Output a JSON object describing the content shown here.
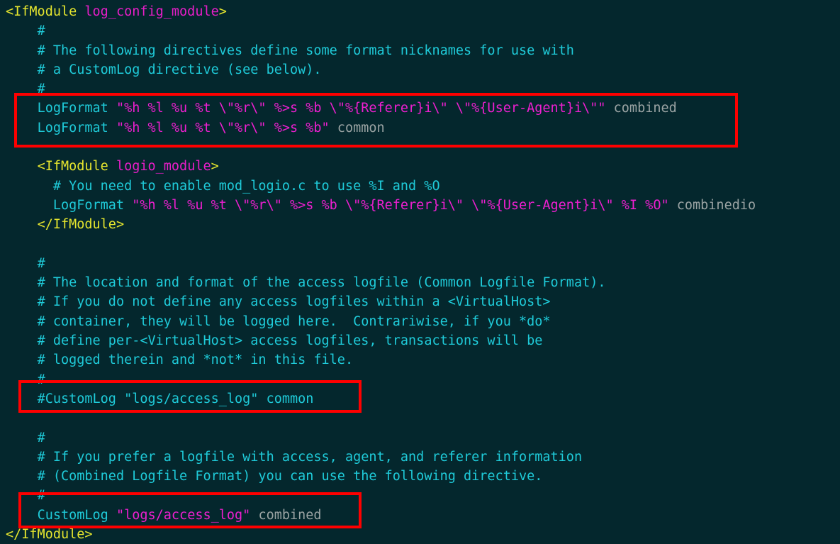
{
  "window": {
    "background_color": "#04272d",
    "content_type": "apache-httpd-config",
    "highlight_color": "#ff0000"
  },
  "colors": {
    "tag": "#e5e52e",
    "module_name": "#e81ec8",
    "comment": "#1fcbd9",
    "directive": "#1fcbd9",
    "string": "#ee1fd0",
    "argument": "#9aa3a3"
  },
  "code_lines": [
    {
      "indent": 0,
      "tokens": [
        {
          "text": "<IfModule ",
          "type": "tag"
        },
        {
          "text": "log_config_module",
          "type": "module"
        },
        {
          "text": ">",
          "type": "tag"
        }
      ]
    },
    {
      "indent": 4,
      "tokens": [
        {
          "text": "#",
          "type": "comment"
        }
      ]
    },
    {
      "indent": 4,
      "tokens": [
        {
          "text": "# The following directives define some format nicknames for use with",
          "type": "comment"
        }
      ]
    },
    {
      "indent": 4,
      "tokens": [
        {
          "text": "# a CustomLog directive (see below).",
          "type": "comment"
        }
      ]
    },
    {
      "indent": 4,
      "tokens": [
        {
          "text": "#",
          "type": "comment"
        }
      ]
    },
    {
      "indent": 4,
      "tokens": [
        {
          "text": "LogFormat ",
          "type": "directive"
        },
        {
          "text": "\"%h %l %u %t \\\"%r\\\" %>s %b \\\"%{Referer}i\\\" \\\"%{User-Agent}i\\\"\"",
          "type": "string"
        },
        {
          "text": " combined",
          "type": "argument"
        }
      ]
    },
    {
      "indent": 4,
      "tokens": [
        {
          "text": "LogFormat ",
          "type": "directive"
        },
        {
          "text": "\"%h %l %u %t \\\"%r\\\" %>s %b\"",
          "type": "string"
        },
        {
          "text": " common",
          "type": "argument"
        }
      ]
    },
    {
      "indent": 0,
      "tokens": []
    },
    {
      "indent": 4,
      "tokens": [
        {
          "text": "<IfModule ",
          "type": "tag"
        },
        {
          "text": "logio_module",
          "type": "module"
        },
        {
          "text": ">",
          "type": "tag"
        }
      ]
    },
    {
      "indent": 6,
      "tokens": [
        {
          "text": "# You need to enable mod_logio.c to use %I and %O",
          "type": "comment"
        }
      ]
    },
    {
      "indent": 6,
      "tokens": [
        {
          "text": "LogFormat ",
          "type": "directive"
        },
        {
          "text": "\"%h %l %u %t \\\"%r\\\" %>s %b \\\"%{Referer}i\\\" \\\"%{User-Agent}i\\\" %I %O\"",
          "type": "string"
        },
        {
          "text": " combinedio",
          "type": "argument"
        }
      ]
    },
    {
      "indent": 4,
      "tokens": [
        {
          "text": "</IfModule>",
          "type": "tag"
        }
      ]
    },
    {
      "indent": 0,
      "tokens": []
    },
    {
      "indent": 4,
      "tokens": [
        {
          "text": "#",
          "type": "comment"
        }
      ]
    },
    {
      "indent": 4,
      "tokens": [
        {
          "text": "# The location and format of the access logfile (Common Logfile Format).",
          "type": "comment"
        }
      ]
    },
    {
      "indent": 4,
      "tokens": [
        {
          "text": "# If you do not define any access logfiles within a <VirtualHost>",
          "type": "comment"
        }
      ]
    },
    {
      "indent": 4,
      "tokens": [
        {
          "text": "# container, they will be logged here.  Contrariwise, if you *do*",
          "type": "comment"
        }
      ]
    },
    {
      "indent": 4,
      "tokens": [
        {
          "text": "# define per-<VirtualHost> access logfiles, transactions will be",
          "type": "comment"
        }
      ]
    },
    {
      "indent": 4,
      "tokens": [
        {
          "text": "# logged therein and *not* in this file.",
          "type": "comment"
        }
      ]
    },
    {
      "indent": 4,
      "tokens": [
        {
          "text": "#",
          "type": "comment"
        }
      ]
    },
    {
      "indent": 4,
      "tokens": [
        {
          "text": "#CustomLog \"logs/access_log\" common",
          "type": "comment"
        }
      ]
    },
    {
      "indent": 0,
      "tokens": []
    },
    {
      "indent": 4,
      "tokens": [
        {
          "text": "#",
          "type": "comment"
        }
      ]
    },
    {
      "indent": 4,
      "tokens": [
        {
          "text": "# If you prefer a logfile with access, agent, and referer information",
          "type": "comment"
        }
      ]
    },
    {
      "indent": 4,
      "tokens": [
        {
          "text": "# (Combined Logfile Format) you can use the following directive.",
          "type": "comment"
        }
      ]
    },
    {
      "indent": 4,
      "tokens": [
        {
          "text": "#",
          "type": "comment"
        }
      ]
    },
    {
      "indent": 4,
      "tokens": [
        {
          "text": "CustomLog ",
          "type": "directive"
        },
        {
          "text": "\"logs/access_log\"",
          "type": "string"
        },
        {
          "text": " combined",
          "type": "argument"
        }
      ]
    },
    {
      "indent": 0,
      "tokens": [
        {
          "text": "</IfModule>",
          "type": "tag"
        }
      ]
    }
  ],
  "annotations": [
    {
      "id": "hl-logformat",
      "label": "logformat-directives-highlight"
    },
    {
      "id": "hl-customlog-commented",
      "label": "commented-customlog-highlight"
    },
    {
      "id": "hl-customlog-active",
      "label": "active-customlog-highlight"
    }
  ]
}
